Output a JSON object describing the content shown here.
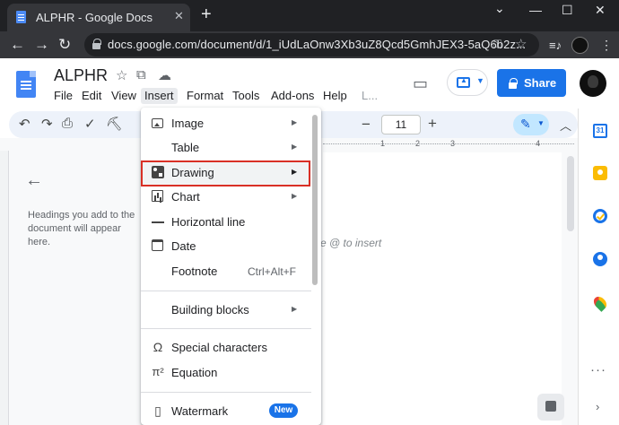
{
  "browser": {
    "tab_title": "ALPHR - Google Docs",
    "tab_close": "✕",
    "new_tab": "+",
    "window_minimize": "—",
    "window_maximize": "☐",
    "window_close": "✕",
    "window_collapse": "⌄",
    "url": "docs.google.com/document/d/1_iUdLaOnw3Xb3uZ8Qcd5GmhJEX3-5aQ6b2z..."
  },
  "docs": {
    "title": "ALPHR",
    "menu": [
      "File",
      "Edit",
      "View",
      "Insert",
      "Format",
      "Tools",
      "Add-ons",
      "Help",
      "L..."
    ],
    "share_label": "Share",
    "font_size": "11",
    "outline_text": "Headings you add to the document will appear here.",
    "body_placeholder": "e @ to insert"
  },
  "ruler": {
    "marks": [
      "1",
      "2",
      "3",
      "4"
    ]
  },
  "side_panel": {
    "calendar_day": "31"
  },
  "insert_menu": {
    "items": [
      {
        "label": "Image",
        "icon": "image-icon",
        "submenu": true
      },
      {
        "label": "Table",
        "icon": "",
        "submenu": true
      },
      {
        "label": "Drawing",
        "icon": "drawing-icon",
        "submenu": true,
        "highlighted": true
      },
      {
        "label": "Chart",
        "icon": "chart-icon",
        "submenu": true
      },
      {
        "label": "Horizontal line",
        "icon": "horizontal-line-icon",
        "submenu": false
      },
      {
        "label": "Date",
        "icon": "calendar-icon",
        "submenu": false
      },
      {
        "label": "Footnote",
        "icon": "",
        "shortcut": "Ctrl+Alt+F"
      },
      {
        "label": "Building blocks",
        "icon": "",
        "submenu": true
      },
      {
        "label": "Special characters",
        "icon": "omega-icon",
        "symbol": "Ω"
      },
      {
        "label": "Equation",
        "icon": "pi-icon",
        "symbol": "π²"
      },
      {
        "label": "Watermark",
        "icon": "watermark-icon",
        "badge": "New"
      }
    ]
  },
  "colors": {
    "accent": "#1a73e8",
    "highlight_outline": "#d93025",
    "chrome_dark": "#202124"
  }
}
